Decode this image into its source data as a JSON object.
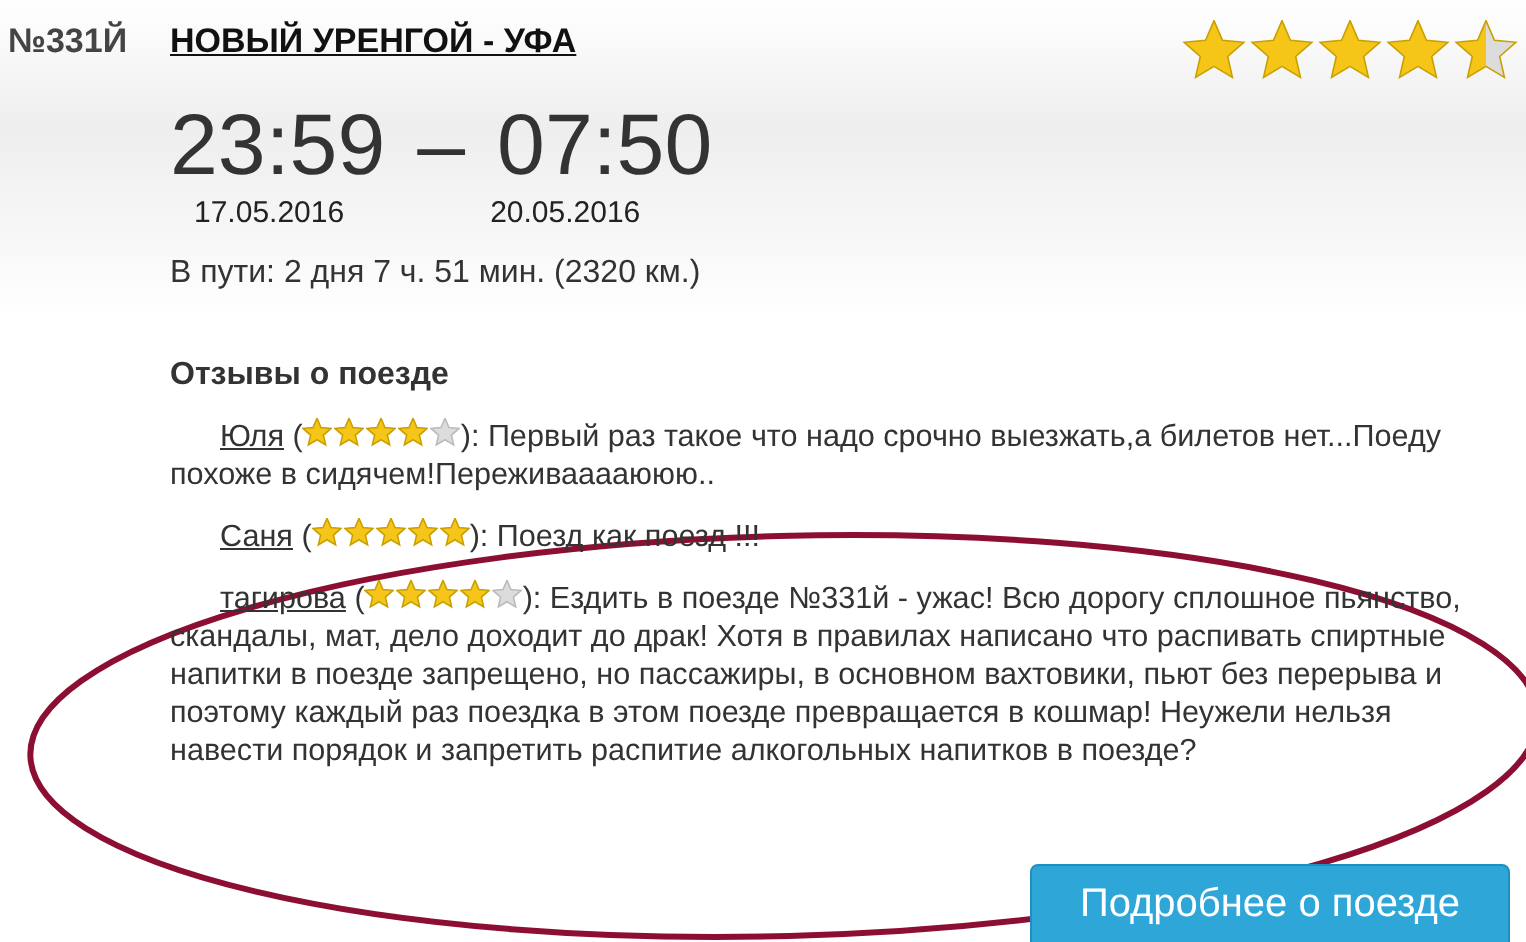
{
  "train": {
    "number": "№331Й",
    "route": "НОВЫЙ УРЕНГОЙ - УФА",
    "stars": 4.5,
    "departure_time": "23:59",
    "separator": "–",
    "arrival_time": "07:50",
    "departure_date": "17.05.2016",
    "arrival_date": "20.05.2016",
    "travel_info": "В пути: 2 дня 7 ч. 51 мин. (2320 км.)"
  },
  "reviews_title": "Отзывы о поезде",
  "reviews": [
    {
      "author": "Юля",
      "paren": "(",
      "stars": 4,
      "text": "): Первый раз такое что надо срочно выезжать,а билетов нет...Поеду похоже в сидячем!Переживааааююю.."
    },
    {
      "author": "Саня",
      "paren": "(",
      "stars": 5,
      "text": "): Поезд как поезд !!!"
    },
    {
      "author": "тагирова",
      "paren": "(",
      "stars": 4,
      "text": "): Ездить в поезде №331й - ужас! Всю дорогу сплошное пьянство, скандалы, мат, дело доходит до драк! Хотя в правилах написано что распивать спиртные напитки в поезде запрещено, но пассажиры, в основном вахтовики, пьют без перерыва и поэтому каждый раз поездка в этом поезде превращается в кошмар! Неужели нельзя навести порядок и запретить распитие алкогольных напитков в поезде?"
    }
  ],
  "details_button": "Подробнее о поезде"
}
